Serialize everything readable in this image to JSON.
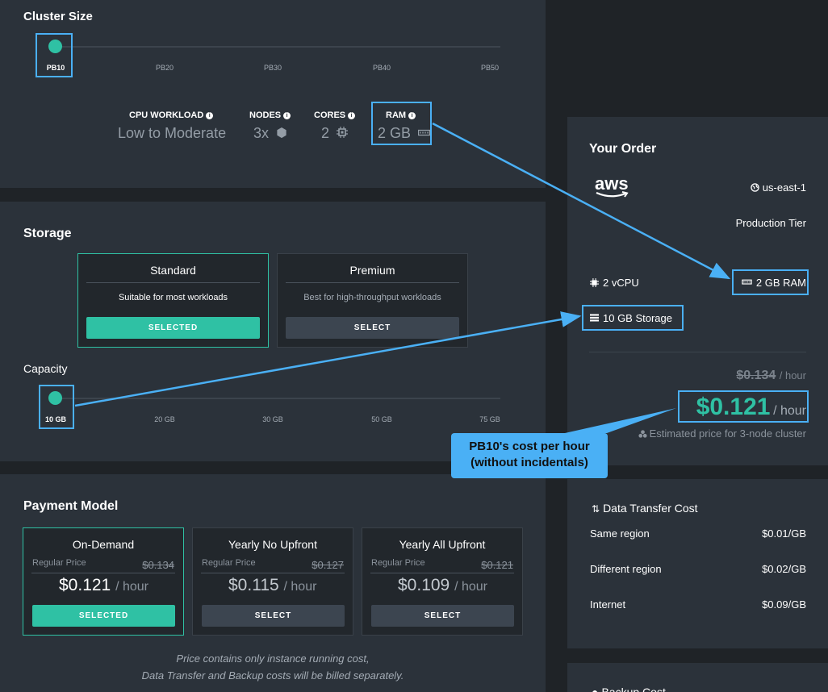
{
  "cluster": {
    "title": "Cluster Size",
    "ticks": [
      "PB10",
      "PB20",
      "PB30",
      "PB40",
      "PB50"
    ],
    "selected": "PB10",
    "specs": {
      "workload_label": "CPU WORKLOAD",
      "workload_value": "Low to Moderate",
      "nodes_label": "NODES",
      "nodes_value": "3x",
      "cores_label": "CORES",
      "cores_value": "2",
      "ram_label": "RAM",
      "ram_value": "2 GB"
    }
  },
  "storage": {
    "title": "Storage",
    "options": [
      {
        "title": "Standard",
        "desc": "Suitable for most workloads",
        "button": "SELECTED"
      },
      {
        "title": "Premium",
        "desc": "Best for high-throughput workloads",
        "button": "SELECT"
      }
    ],
    "capacity_label": "Capacity",
    "capacity_ticks": [
      "10 GB",
      "20 GB",
      "30 GB",
      "50 GB",
      "75 GB"
    ],
    "capacity_selected": "10 GB"
  },
  "payment": {
    "title": "Payment Model",
    "regular_label": "Regular Price",
    "per_hour": "/ hour",
    "options": [
      {
        "title": "On-Demand",
        "regular": "$0.134",
        "price": "$0.121",
        "button": "SELECTED"
      },
      {
        "title": "Yearly No Upfront",
        "regular": "$0.127",
        "price": "$0.115",
        "button": "SELECT"
      },
      {
        "title": "Yearly All Upfront",
        "regular": "$0.121",
        "price": "$0.109",
        "button": "SELECT"
      }
    ],
    "note_line1": "Price contains only instance running cost,",
    "note_line2": "Data Transfer and Backup costs will be billed separately."
  },
  "order": {
    "title": "Your Order",
    "provider": "aws",
    "region": "us-east-1",
    "tier": "Production Tier",
    "cpu": "2 vCPU",
    "ram": "2 GB RAM",
    "storage": "10 GB Storage",
    "old_price": "$0.134",
    "price": "$0.121",
    "per_hour": "/ hour",
    "estimate_note": "Estimated price for 3-node cluster"
  },
  "transfer": {
    "title": "Data Transfer Cost",
    "rows": [
      {
        "label": "Same region",
        "value": "$0.01/GB"
      },
      {
        "label": "Different region",
        "value": "$0.02/GB"
      },
      {
        "label": "Internet",
        "value": "$0.09/GB"
      }
    ]
  },
  "backup": {
    "title": "Backup Cost"
  },
  "annotation": {
    "line1": "PB10's cost per hour",
    "line2": "(without incidentals)"
  },
  "colors": {
    "accent": "#2fc1a4",
    "highlight": "#4ab0f5",
    "panel": "#2b323a"
  }
}
